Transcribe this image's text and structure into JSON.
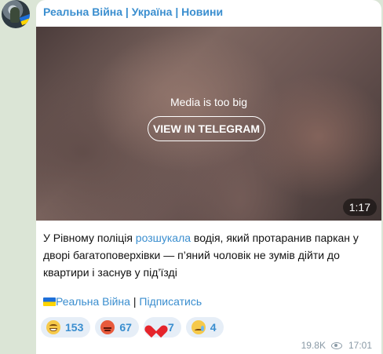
{
  "channel": {
    "name": "Реальна Війна | Україна | Новини"
  },
  "media": {
    "notice": "Media is too big",
    "button_label": "VIEW IN TELEGRAM",
    "duration": "1:17"
  },
  "caption": {
    "part1": "У Рівному поліція ",
    "link_word": "розшукала",
    "part2": " водія, який протаранив паркан у дворі багатоповерхівки — п’яний чоловік не зумів дійти до квартири і заснув у під’їзді"
  },
  "signature": {
    "channel_link": "Реальна Війна",
    "separator": " | ",
    "subscribe_link": "Підписатись"
  },
  "reactions": [
    {
      "icon": "grinning-face-icon",
      "count": "153"
    },
    {
      "icon": "angry-face-icon",
      "count": "67"
    },
    {
      "icon": "red-heart-icon",
      "count": "7"
    },
    {
      "icon": "crying-face-icon",
      "count": "4"
    }
  ],
  "footer": {
    "views": "19.8K",
    "time": "17:01"
  },
  "colors": {
    "background": "#dbe5d6",
    "accent": "#3a8ecf",
    "reaction_bg": "#e6eef7"
  }
}
